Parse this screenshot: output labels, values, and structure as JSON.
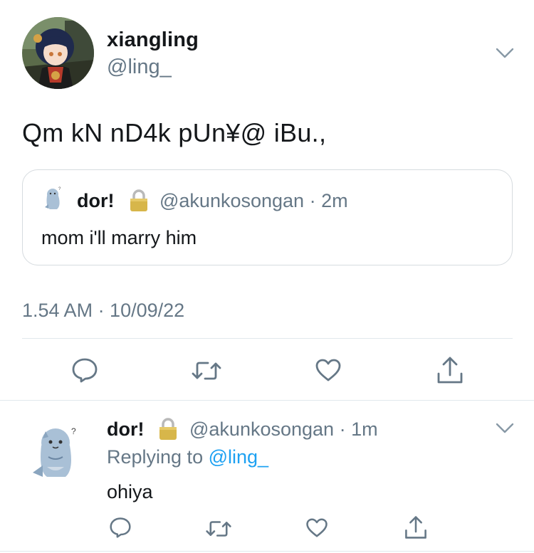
{
  "main_tweet": {
    "author": {
      "display_name": "xiangling",
      "handle": "@ling_"
    },
    "text": "Qm kN nD4k pUn¥@ iBu.,",
    "quoted_tweet": {
      "display_name": "dor!",
      "handle": "@akunkosongan",
      "separator": "·",
      "time_ago": "2m",
      "text": "mom i'll marry him"
    },
    "timestamp": "1.54 AM · 10/09/22"
  },
  "reply_tweet": {
    "display_name": "dor!",
    "handle": "@akunkosongan",
    "separator": "·",
    "time_ago": "1m",
    "replying_prefix": "Replying to",
    "replying_to": "@ling_",
    "text": "ohiya"
  },
  "icons": {
    "reply": "reply-icon",
    "retweet": "retweet-icon",
    "like": "heart-icon",
    "share": "share-icon",
    "menu": "chevron-down-icon",
    "protected": "lock-icon"
  },
  "colors": {
    "text_primary": "#14171a",
    "text_secondary": "#657786",
    "link": "#1da1f2",
    "border": "#e1e8ed",
    "lock_gold": "#d7b64a"
  }
}
